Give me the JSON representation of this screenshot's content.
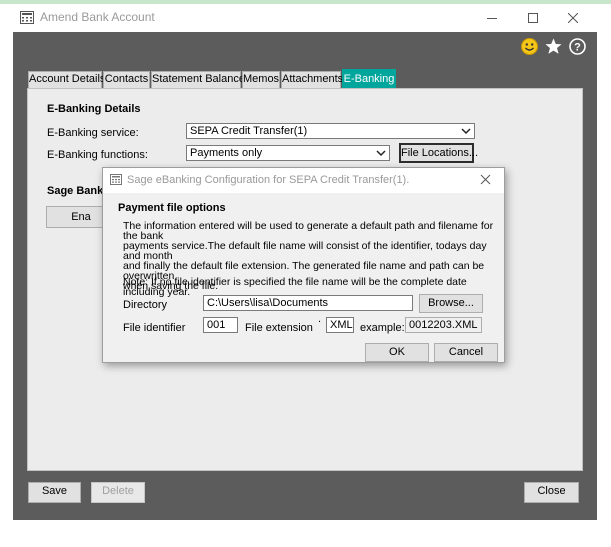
{
  "window": {
    "title": "Amend Bank Account"
  },
  "toolbar": {
    "icons": [
      "smiley-icon",
      "star-icon",
      "help-icon"
    ]
  },
  "tabs": [
    {
      "label": "Account Details"
    },
    {
      "label": "Contacts"
    },
    {
      "label": "Statement Balances"
    },
    {
      "label": "Memos"
    },
    {
      "label": "Attachments"
    },
    {
      "label": "E-Banking",
      "active": true
    }
  ],
  "ebanking": {
    "section_title": "E-Banking Details",
    "service_label": "E-Banking service:",
    "service_value": "SEPA Credit Transfer(1)",
    "functions_label": "E-Banking functions:",
    "functions_value": "Payments only",
    "file_locations_button": "File Locations...",
    "sage_section_title": "Sage Bank F",
    "enable_button": "Ena"
  },
  "dialog": {
    "title": "Sage eBanking Configuration for SEPA Credit Transfer(1).",
    "section_title": "Payment file options",
    "description_lines": [
      "The information entered will be used to generate a default path and filename for the bank",
      "payments service.The default file name will consist of the identifier, todays day and month",
      "and finally the default file extension. The generated file name and path can be overwritten",
      "when saving the file."
    ],
    "note": "Note: If no file identifier is specified the file name will be the complete date including year.",
    "directory_label": "Directory",
    "directory_value": "C:\\Users\\lisa\\Documents",
    "browse_button": "Browse...",
    "file_identifier_label": "File identifier",
    "file_identifier_value": "001",
    "file_extension_label": "File extension",
    "file_extension_value": "XML",
    "dot": ".",
    "example_label": "example:",
    "example_value": "0012203.XML",
    "ok_button": "OK",
    "cancel_button": "Cancel"
  },
  "footer": {
    "save_button": "Save",
    "delete_button": "Delete",
    "close_button": "Close"
  },
  "colors": {
    "window_frame": "#5c5c5c",
    "active_tab": "#00a69c",
    "panel": "#ececec"
  }
}
